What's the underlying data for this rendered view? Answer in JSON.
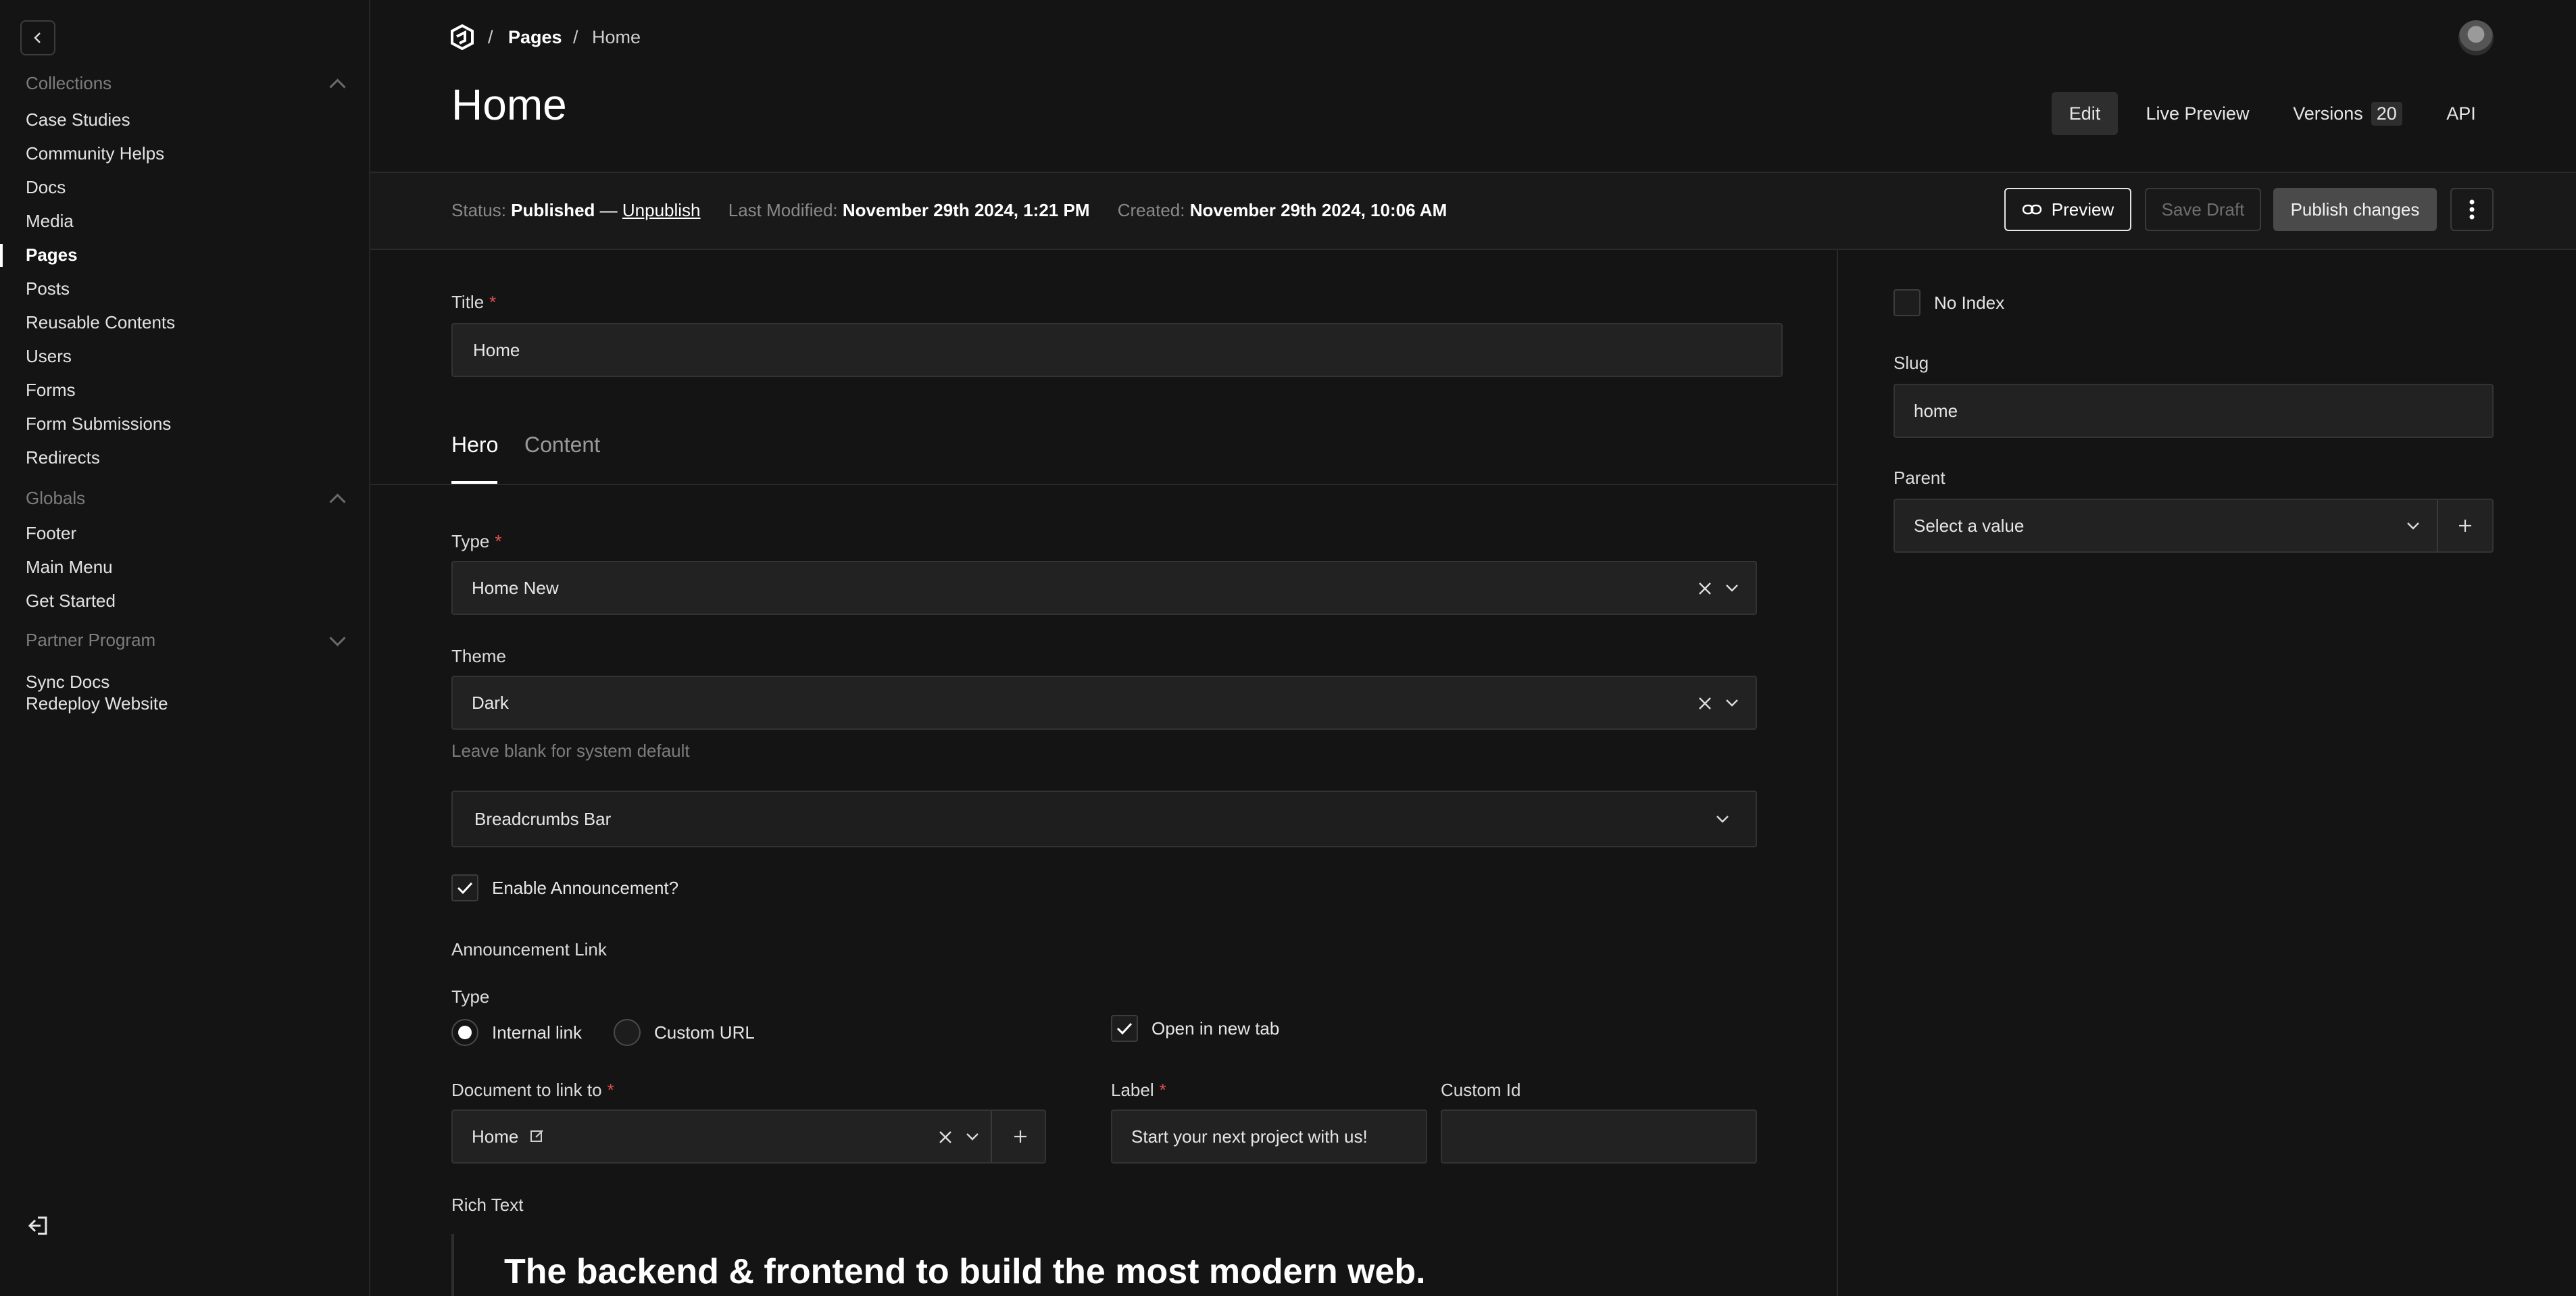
{
  "sidebar": {
    "groups": [
      {
        "label": "Collections",
        "items": [
          "Case Studies",
          "Community Helps",
          "Docs",
          "Media",
          "Pages",
          "Posts",
          "Reusable Contents",
          "Users",
          "Forms",
          "Form Submissions",
          "Redirects"
        ]
      },
      {
        "label": "Globals",
        "items": [
          "Footer",
          "Main Menu",
          "Get Started"
        ]
      },
      {
        "label": "Partner Program",
        "items": []
      }
    ],
    "extra": [
      "Sync Docs",
      "Redeploy Website"
    ],
    "active": "Pages"
  },
  "breadcrumb": {
    "sep": "/",
    "items": [
      "Pages",
      "Home"
    ]
  },
  "page_title": "Home",
  "view_tabs": {
    "edit": "Edit",
    "live_preview": "Live Preview",
    "versions": "Versions",
    "versions_count": "20",
    "api": "API"
  },
  "status_bar": {
    "status_label": "Status:",
    "status_value": "Published",
    "dash": "—",
    "unpublish": "Unpublish",
    "modified_label": "Last Modified:",
    "modified_value": "November 29th 2024, 1:21 PM",
    "created_label": "Created:",
    "created_value": "November 29th 2024, 10:06 AM"
  },
  "actions": {
    "preview": "Preview",
    "save_draft": "Save Draft",
    "publish": "Publish changes"
  },
  "form": {
    "title_label": "Title",
    "title_value": "Home",
    "tabs": [
      "Hero",
      "Content"
    ],
    "type_label": "Type",
    "type_value": "Home New",
    "theme_label": "Theme",
    "theme_value": "Dark",
    "theme_help": "Leave blank for system default",
    "breadcrumbs_bar": "Breadcrumbs Bar",
    "announcement_checkbox": "Enable Announcement?",
    "announcement_link": "Announcement Link",
    "link_type_label": "Type",
    "internal_link": "Internal link",
    "custom_url": "Custom URL",
    "open_new_tab": "Open in new tab",
    "doc_label": "Document to link to",
    "doc_value": "Home",
    "label_label": "Label",
    "label_value": "Start your next project with us!",
    "custom_id_label": "Custom Id",
    "custom_id_value": "",
    "rich_text_label": "Rich Text",
    "rich_text_heading": "The backend & frontend to build the most modern web."
  },
  "side_panel": {
    "no_index": "No Index",
    "slug_label": "Slug",
    "slug_value": "home",
    "parent_label": "Parent",
    "parent_placeholder": "Select a value"
  },
  "colors": {
    "background": "#141414",
    "field": "#222222",
    "required": "#e0524f"
  }
}
